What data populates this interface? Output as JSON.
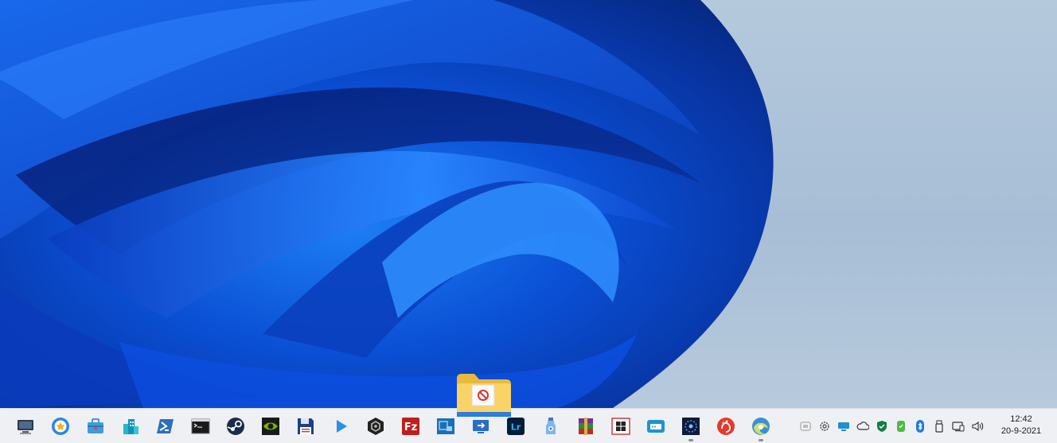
{
  "taskbar": {
    "apps": [
      {
        "name": "this-pc-icon",
        "label": "This PC",
        "running": false
      },
      {
        "name": "starred-app-icon",
        "label": "Favorites",
        "running": false
      },
      {
        "name": "toolbox-icon",
        "label": "Toolbox",
        "running": false
      },
      {
        "name": "buildings-icon",
        "label": "City App",
        "running": false
      },
      {
        "name": "powershell-icon",
        "label": "PowerShell",
        "running": false
      },
      {
        "name": "terminal-icon",
        "label": "Command Prompt",
        "running": false
      },
      {
        "name": "steam-icon",
        "label": "Steam",
        "running": false
      },
      {
        "name": "nvidia-icon",
        "label": "NVIDIA",
        "running": false
      },
      {
        "name": "floppy-disk-icon",
        "label": "Save Tool",
        "running": false
      },
      {
        "name": "play-icon",
        "label": "Media Player",
        "running": false
      },
      {
        "name": "hexagon-app-icon",
        "label": "Hex App",
        "running": false
      },
      {
        "name": "filezilla-icon",
        "label": "FileZilla",
        "running": false
      },
      {
        "name": "editor-icon",
        "label": "Editor",
        "running": false
      },
      {
        "name": "remote-desktop-icon",
        "label": "Remote Desktop",
        "running": false
      },
      {
        "name": "lightroom-icon",
        "label": "Lightroom",
        "running": false
      },
      {
        "name": "bottle-icon",
        "label": "Bottle App",
        "running": false
      },
      {
        "name": "winrar-icon",
        "label": "WinRAR",
        "running": false
      },
      {
        "name": "windows-store-icon",
        "label": "Microsoft Store",
        "running": false
      },
      {
        "name": "router-app-icon",
        "label": "Network App",
        "running": false
      },
      {
        "name": "radial-app-icon",
        "label": "Radial App",
        "running": true
      },
      {
        "name": "handprint-icon",
        "label": "Hand App",
        "running": false
      },
      {
        "name": "edge-beta-icon",
        "label": "Edge",
        "running": true
      }
    ],
    "tray": [
      {
        "name": "teams-tray-icon"
      },
      {
        "name": "settings-tray-icon"
      },
      {
        "name": "monitor-tray-icon"
      },
      {
        "name": "onedrive-cloud-icon"
      },
      {
        "name": "defender-shield-icon"
      },
      {
        "name": "security-green-icon"
      },
      {
        "name": "bluetooth-icon"
      },
      {
        "name": "usb-drive-icon"
      },
      {
        "name": "network-icon"
      },
      {
        "name": "volume-icon"
      }
    ],
    "clock": {
      "time": "12:42",
      "date": "20-9-2021"
    }
  },
  "drag_preview": {
    "icon": "folder-no-drop-icon"
  }
}
